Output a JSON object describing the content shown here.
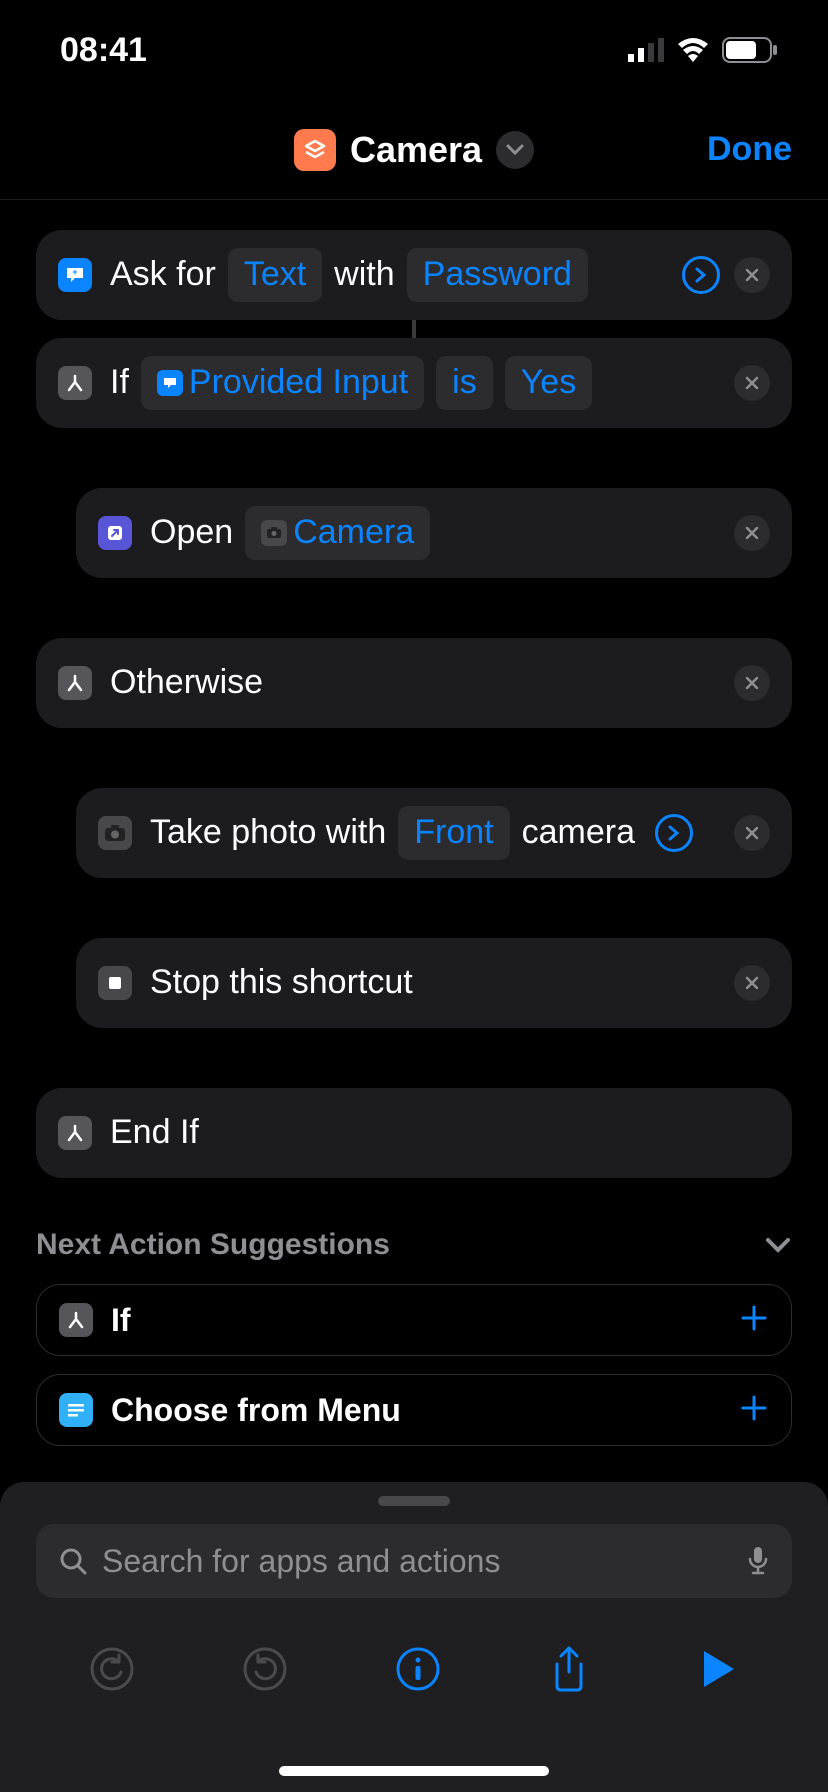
{
  "status": {
    "time": "08:41"
  },
  "header": {
    "title": "Camera",
    "done": "Done"
  },
  "actions": {
    "a0": {
      "t0": "Ask for",
      "p0": "Text",
      "t1": "with",
      "p1": "Password"
    },
    "a1": {
      "t0": "If",
      "p0": "Provided Input",
      "p1": "is",
      "p2": "Yes"
    },
    "a2": {
      "t0": "Open",
      "p0": "Camera"
    },
    "a3": {
      "t0": "Otherwise"
    },
    "a4": {
      "t0": "Take photo with",
      "p0": "Front",
      "t1": "camera"
    },
    "a5": {
      "t0": "Stop this shortcut"
    },
    "a6": {
      "t0": "End If"
    }
  },
  "suggestions": {
    "heading": "Next Action Suggestions",
    "s0": "If",
    "s1": "Choose from Menu"
  },
  "search": {
    "placeholder": "Search for apps and actions"
  }
}
